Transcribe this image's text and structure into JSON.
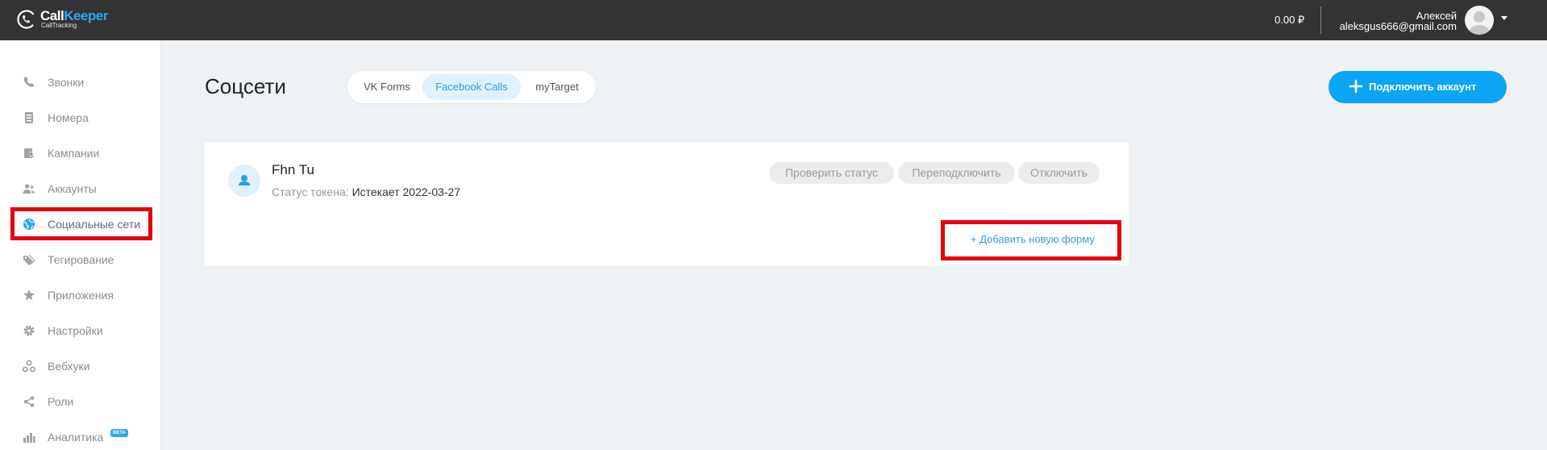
{
  "brand": {
    "name_part1": "Call",
    "name_part2": "Keeper",
    "subtitle": "CallTracking"
  },
  "header": {
    "balance": "0.00 ₽",
    "user_name": "Алексей",
    "user_email": "aleksgus666@gmail.com"
  },
  "sidebar": {
    "items": [
      {
        "label": "Звонки",
        "icon": "phone-icon"
      },
      {
        "label": "Номера",
        "icon": "numbers-icon"
      },
      {
        "label": "Кампании",
        "icon": "campaigns-icon"
      },
      {
        "label": "Аккаунты",
        "icon": "accounts-icon"
      },
      {
        "label": "Социальные сети",
        "icon": "social-networks-icon",
        "active": true
      },
      {
        "label": "Тегирование",
        "icon": "tags-icon"
      },
      {
        "label": "Приложения",
        "icon": "apps-icon"
      },
      {
        "label": "Настройки",
        "icon": "gear-icon"
      },
      {
        "label": "Вебхуки",
        "icon": "webhooks-icon"
      },
      {
        "label": "Роли",
        "icon": "share-icon"
      },
      {
        "label": "Аналитика",
        "icon": "analytics-icon",
        "badge": "BETA"
      }
    ]
  },
  "main": {
    "title": "Соцсети",
    "tabs": [
      {
        "label": "VK Forms"
      },
      {
        "label": "Facebook Calls",
        "active": true
      },
      {
        "label": "myTarget"
      }
    ],
    "connect_button": "Подключить аккаунт",
    "account": {
      "name": "Fhn Tu",
      "token_label": "Статус токена:",
      "token_value": "Истекает 2022-03-27",
      "actions": [
        "Проверить статус",
        "Переподключить",
        "Отключить"
      ],
      "add_form": "+ Добавить новую форму"
    }
  },
  "colors": {
    "topbar": "#333333",
    "accent": "#0aa5f5",
    "highlight": "#e3000f",
    "page_bg": "#eef2f5"
  }
}
